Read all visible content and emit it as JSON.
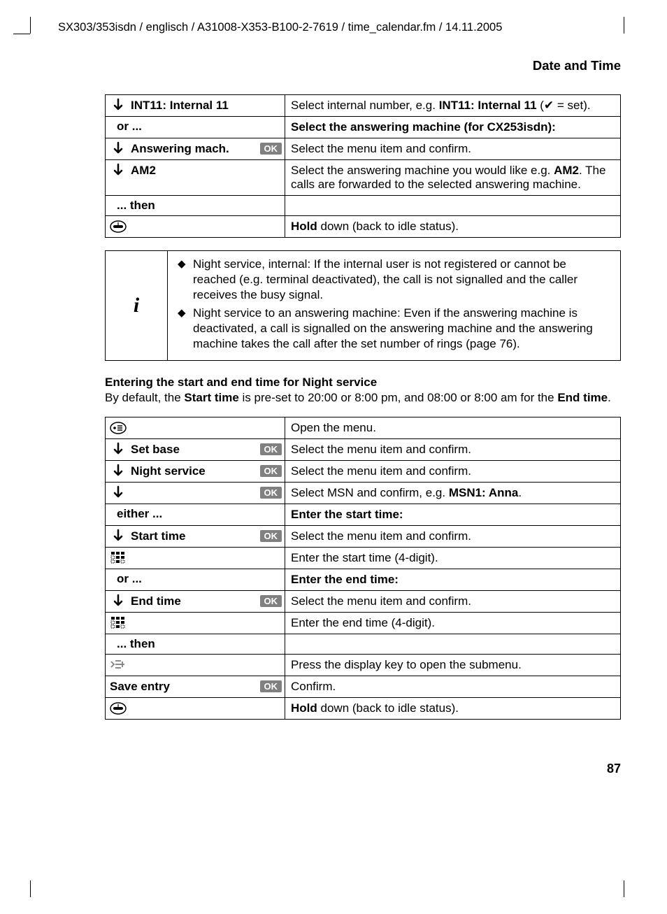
{
  "header": {
    "docPath": "SX303/353isdn / englisch / A31008-X353-B100-2-7619 / time_calendar.fm / 14.11.2005",
    "sectionTitle": "Date and Time"
  },
  "table1": {
    "rows": [
      {
        "iconType": "arrow",
        "label": "INT11: Internal 11",
        "ok": false,
        "desc_html": "Select internal number, e.g. <b>INT11: Internal 11</b> (✔ = set)."
      },
      {
        "iconType": "flow",
        "flowText": "or ...",
        "desc_html": "<b>Select the answering machine (for CX253isdn):</b>"
      },
      {
        "iconType": "arrow",
        "label": "Answering mach.",
        "ok": true,
        "desc_html": "Select the menu item and confirm."
      },
      {
        "iconType": "arrow",
        "label": "AM2",
        "ok": false,
        "desc_html": "Select the answering machine you would like e.g. <b>AM2</b>. The calls are forwarded to the selected answering machine."
      },
      {
        "iconType": "flow",
        "flowText": "... then",
        "desc_html": ""
      },
      {
        "iconType": "hangup",
        "desc_html": "<b>Hold</b> down (back to idle status)."
      }
    ]
  },
  "infoBox": {
    "bullets": [
      "Night service, internal: If the internal user is not registered or cannot be reached (e.g. terminal deactivated), the call is not signalled and the caller receives the busy signal.",
      "Night service to an answering machine: Even if the answering machine is deactivated, a call is signalled on the answering machine and the answering machine takes the call after the set number of rings (page 76)."
    ]
  },
  "subheading": "Entering the start and end time for Night service",
  "paragraph_html": "By default, the <b>Start time</b> is pre-set to 20:00 or 8:00 pm, and 08:00 or 8:00 am for the <b>End time</b>.",
  "table2": {
    "rows": [
      {
        "iconType": "menu",
        "desc_html": "Open the menu."
      },
      {
        "iconType": "arrow",
        "label": "Set base",
        "ok": true,
        "desc_html": "Select the menu item and confirm."
      },
      {
        "iconType": "arrow",
        "label": "Night service",
        "ok": true,
        "desc_html": "Select the menu item and confirm."
      },
      {
        "iconType": "arrow",
        "label": "",
        "ok": true,
        "desc_html": "Select MSN and confirm, e.g. <b>MSN1: Anna</b>."
      },
      {
        "iconType": "flow",
        "flowText": "either ...",
        "desc_html": "<b>Enter the start time:</b>"
      },
      {
        "iconType": "arrow",
        "label": "Start time",
        "ok": true,
        "desc_html": "Select the menu item and confirm."
      },
      {
        "iconType": "keypad",
        "desc_html": "Enter the start time (4-digit)."
      },
      {
        "iconType": "flow",
        "flowText": "or ...",
        "desc_html": "<b>Enter the end time:</b>"
      },
      {
        "iconType": "arrow",
        "label": "End time",
        "ok": true,
        "desc_html": "Select the menu item and confirm."
      },
      {
        "iconType": "keypad",
        "desc_html": "Enter the end time (4-digit)."
      },
      {
        "iconType": "flow",
        "flowText": "... then",
        "desc_html": ""
      },
      {
        "iconType": "submenu",
        "desc_html": "Press the display key to open the submenu."
      },
      {
        "iconType": "plain",
        "label": "Save entry",
        "ok": true,
        "desc_html": "Confirm."
      },
      {
        "iconType": "hangup",
        "desc_html": "<b>Hold</b> down (back to idle status)."
      }
    ]
  },
  "pageNumber": "87",
  "okLabel": "OK"
}
